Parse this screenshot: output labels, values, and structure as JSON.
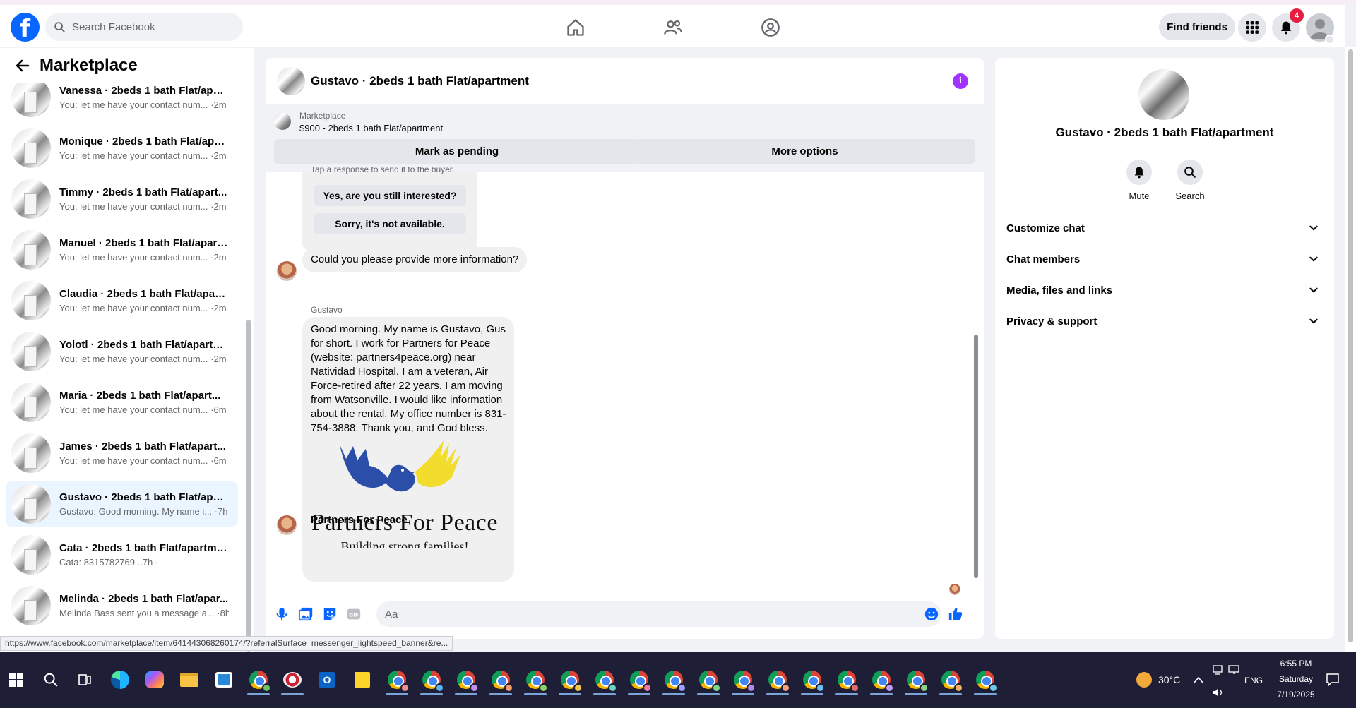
{
  "topbar": {
    "search_placeholder": "Search Facebook",
    "find_friends": "Find friends",
    "notification_count": "4"
  },
  "sidebar": {
    "title": "Marketplace",
    "conversations": [
      {
        "name": "Vanessa · 2beds 1 bath Flat/apar...",
        "preview": "You: let me have your contact num... ·2m"
      },
      {
        "name": "Monique · 2beds 1 bath Flat/apa...",
        "preview": "You: let me have your contact num... ·2m"
      },
      {
        "name": "Timmy · 2beds 1 bath Flat/apart...",
        "preview": "You: let me have your contact num... ·2m"
      },
      {
        "name": "Manuel · 2beds 1 bath Flat/apart...",
        "preview": "You: let me have your contact num... ·2m"
      },
      {
        "name": "Claudia · 2beds 1 bath Flat/apart...",
        "preview": "You: let me have your contact num... ·2m"
      },
      {
        "name": "Yolotl · 2beds 1 bath Flat/apartm...",
        "preview": "You: let me have your contact num... ·2m"
      },
      {
        "name": "Maria · 2beds 1 bath Flat/apart...",
        "preview": "You: let me have your contact num... ·6m"
      },
      {
        "name": "James · 2beds 1 bath Flat/apart...",
        "preview": "You: let me have your contact num... ·6m"
      },
      {
        "name": "Gustavo · 2beds 1 bath Flat/apar...",
        "preview": "Gustavo: Good morning. My name i... ·7h"
      },
      {
        "name": "Cata · 2beds 1 bath Flat/apartme...",
        "preview": "Cata: 8315782769 ..7h ·"
      },
      {
        "name": "Melinda · 2beds 1 bath Flat/apar...",
        "preview": "Melinda Bass sent you a message a... ·8h"
      }
    ],
    "status_url": "https://www.facebook.com/marketplace/item/641443068260174/?referralSurface=messenger_lightspeed_banner&re..."
  },
  "chat": {
    "title": "Gustavo · 2beds 1 bath Flat/apartment",
    "marketplace_label": "Marketplace",
    "listing": "$900 - 2beds 1 bath Flat/apartment",
    "mark_pending": "Mark as pending",
    "more_options": "More options",
    "quick_reply_hint": "Tap a response to send it to the buyer.",
    "quick_replies": [
      "Yes, are you still interested?",
      "Sorry, it's not available."
    ],
    "auto_message": "Could you please provide more information?",
    "sender": "Gustavo",
    "message": "Good morning. My name is Gustavo, Gus for short. I work for Partners for Peace (website: partners4peace.org) near Natividad Hospital. I am a veteran, Air Force-retired after 22 years. I am moving from Watsonville. I would like information about the rental. My office number is 831-754-3888. Thank you, and God bless.",
    "image_title": "Partners For Peace",
    "image_subtitle": "Building strong families!",
    "link_title": "Partners For Peace",
    "composer_placeholder": "Aa"
  },
  "right_panel": {
    "name": "Gustavo · 2beds 1 bath Flat/apartment",
    "actions": [
      "Mute",
      "Search"
    ],
    "sections": [
      "Customize chat",
      "Chat members",
      "Media, files and links",
      "Privacy & support"
    ]
  },
  "taskbar": {
    "weather": "30°C",
    "lang": "ENG",
    "time": "6:55 PM",
    "day": "Saturday",
    "date": "7/19/2025"
  },
  "colors": {
    "facebook_blue": "#0866ff",
    "active_convo": "#ebf5ff",
    "info_purple": "#a033ff",
    "dove_blue": "#2b4fa8",
    "hand_yellow": "#f2dc2c",
    "taskbar_bg": "#1f1e37"
  }
}
